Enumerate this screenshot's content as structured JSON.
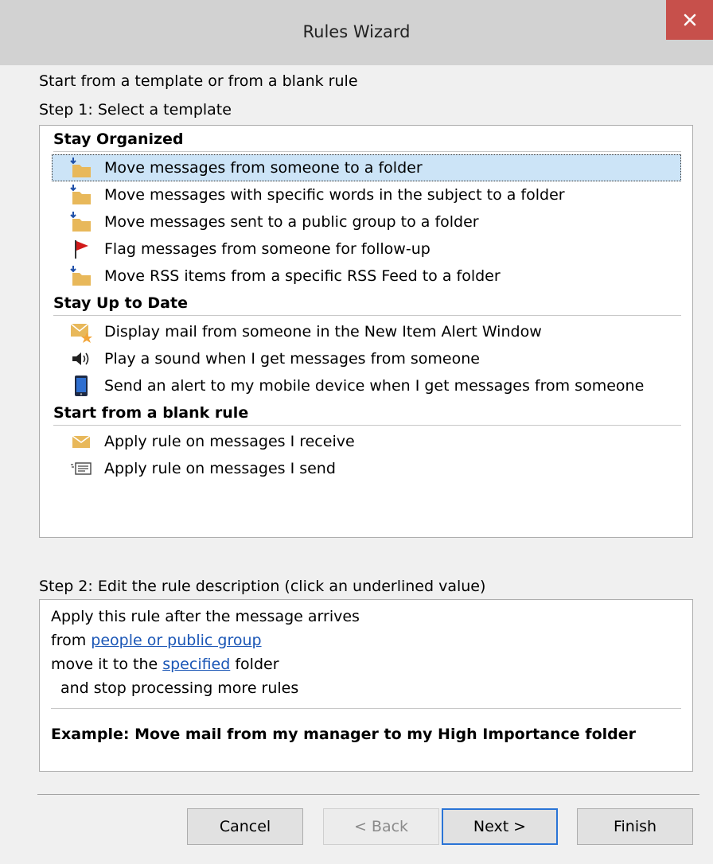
{
  "window": {
    "title": "Rules Wizard"
  },
  "header": {
    "intro": "Start from a template or from a blank rule",
    "step1": "Step 1: Select a template"
  },
  "templates": {
    "stay_organized": {
      "label": "Stay Organized",
      "items": [
        "Move messages from someone to a folder",
        "Move messages with specific words in the subject to a folder",
        "Move messages sent to a public group to a folder",
        "Flag messages from someone for follow-up",
        "Move RSS items from a specific RSS Feed to a folder"
      ]
    },
    "stay_up_to_date": {
      "label": "Stay Up to Date",
      "items": [
        "Display mail from someone in the New Item Alert Window",
        "Play a sound when I get messages from someone",
        "Send an alert to my mobile device when I get messages from someone"
      ]
    },
    "blank_rule": {
      "label": "Start from a blank rule",
      "items": [
        "Apply rule on messages I receive",
        "Apply rule on messages I send"
      ]
    }
  },
  "step2": {
    "label": "Step 2: Edit the rule description (click an underlined value)",
    "line1": "Apply this rule after the message arrives",
    "line2_prefix": "from ",
    "line2_link": "people or public group",
    "line3_prefix": "move it to the ",
    "line3_link": "specified",
    "line3_suffix": " folder",
    "line4": "and stop processing more rules",
    "example": "Example: Move mail from my manager to my High Importance folder"
  },
  "buttons": {
    "cancel": "Cancel",
    "back": "< Back",
    "next": "Next >",
    "finish": "Finish"
  },
  "colors": {
    "selection": "#cce4f7",
    "link": "#1a56b6",
    "close": "#c7504b",
    "folder": "#e8b85a",
    "flag": "#d11a1a"
  }
}
